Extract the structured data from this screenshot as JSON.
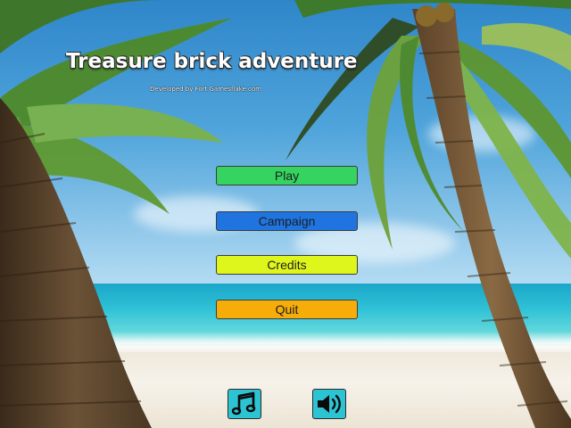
{
  "game": {
    "title": "Treasure brick adventure",
    "subtitle": "Developed by Fort Gamesflake.com"
  },
  "menu": {
    "play": "Play",
    "campaign": "Campaign",
    "credits": "Credits",
    "quit": "Quit"
  },
  "toggles": [
    {
      "icon": "music-note-icon"
    },
    {
      "icon": "speaker-volume-icon"
    }
  ],
  "colors": {
    "play": "#35d35f",
    "campaign": "#1f74e0",
    "credits": "#dff61c",
    "quit": "#f6ad0a",
    "toggle": "#2cc4d3"
  }
}
